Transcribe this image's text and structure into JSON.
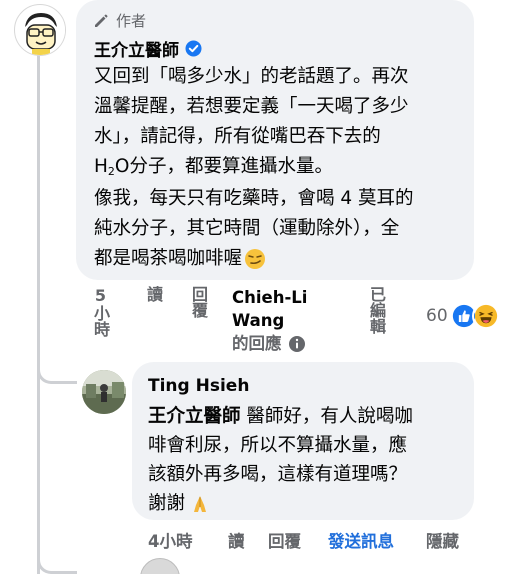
{
  "main_comment": {
    "role_label": "作者",
    "author_name": "王介立醫師",
    "paragraph1_a": "又回到「喝多少水」的老話題了。再次",
    "paragraph1_b": "溫馨提醒，若想要定義「一天喝了多少",
    "paragraph1_c": "水」，請記得，所有從嘴巴吞下去的",
    "paragraph1_d_pre": "H",
    "paragraph1_d_sub": "2",
    "paragraph1_d_post": "O分子，都要算進攝水量。",
    "paragraph2_a": "像我，每天只有吃藥時，會喝 4 莫耳的",
    "paragraph2_b": "純水分子，其它時間（運動除外），全",
    "paragraph2_c": "都是喝茶喝咖啡喔",
    "actions": {
      "time": "5小時",
      "read": "讀",
      "reply": "回覆",
      "edited": "已編輯"
    },
    "replied_by_name": "Chieh-Li Wang",
    "replied_by_name_line1": "Chieh-Li",
    "replied_by_name_line2": "Wang",
    "replied_by_suffix": "的回應",
    "reaction_count": "60",
    "colors": {
      "verified": "#1877f2",
      "like": "#1877f2",
      "haha": "#f7b928"
    }
  },
  "reply": {
    "author_name": "Ting Hsieh",
    "mention": "王介立醫師",
    "line1_rest": " 醫師好，有人說喝咖",
    "line2": "啡會利尿，所以不算攝水量，應",
    "line3": "該額外再多喝，這樣有道理嗎？",
    "line4": "謝謝",
    "actions": {
      "time": "4小時",
      "read": "讀",
      "reply": "回覆",
      "send_message": "發送訊息",
      "hide": "隱藏"
    },
    "colors": {
      "link": "#216fdb"
    }
  }
}
